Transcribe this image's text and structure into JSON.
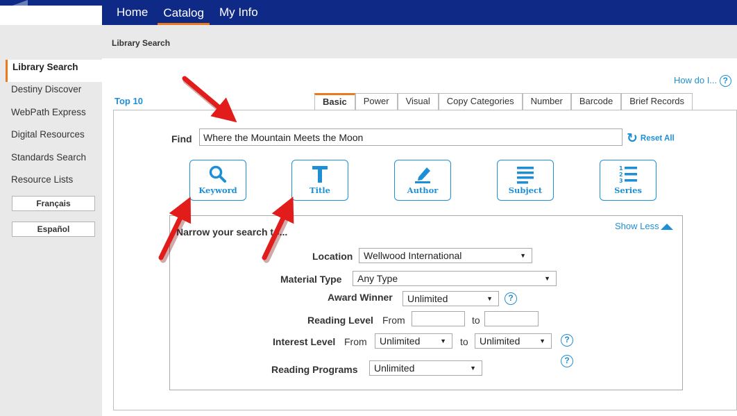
{
  "nav": {
    "items": [
      {
        "label": "Home",
        "active": false
      },
      {
        "label": "Catalog",
        "active": true
      },
      {
        "label": "My Info",
        "active": false
      }
    ]
  },
  "subheader": {
    "title": "Library Search"
  },
  "sidebar": {
    "items": [
      "Library Search",
      "Destiny Discover",
      "WebPath Express",
      "Digital Resources",
      "Standards Search",
      "Resource Lists"
    ],
    "languages": [
      "Français",
      "Español"
    ]
  },
  "help": {
    "how_do_i": "How do I...",
    "icon": "?"
  },
  "top10": "Top 10",
  "tabs": [
    "Basic",
    "Power",
    "Visual",
    "Copy Categories",
    "Number",
    "Barcode",
    "Brief Records"
  ],
  "find": {
    "label": "Find",
    "value": "Where the Mountain Meets the Moon",
    "reset": "Reset All"
  },
  "search_buttons": [
    {
      "label": "Keyword",
      "icon": "search-icon"
    },
    {
      "label": "Title",
      "icon": "title-icon"
    },
    {
      "label": "Author",
      "icon": "pen-icon"
    },
    {
      "label": "Subject",
      "icon": "list-icon"
    },
    {
      "label": "Series",
      "icon": "numbered-list-icon"
    }
  ],
  "narrow": {
    "title": "Narrow your search to...",
    "show_less": "Show Less",
    "location_label": "Location",
    "location_value": "Wellwood International",
    "material_label": "Material Type",
    "material_value": "Any Type",
    "award_label": "Award Winner",
    "award_value": "Unlimited",
    "reading_label": "Reading Level",
    "from": "From",
    "to": "to",
    "interest_label": "Interest Level",
    "interest_from": "Unlimited",
    "interest_to": "Unlimited",
    "programs_label": "Reading Programs",
    "programs_value": "Unlimited"
  },
  "colors": {
    "nav": "#0f2a86",
    "accent": "#ec7a1c",
    "link": "#1e8fd5",
    "arrow": "#e21b1b"
  }
}
